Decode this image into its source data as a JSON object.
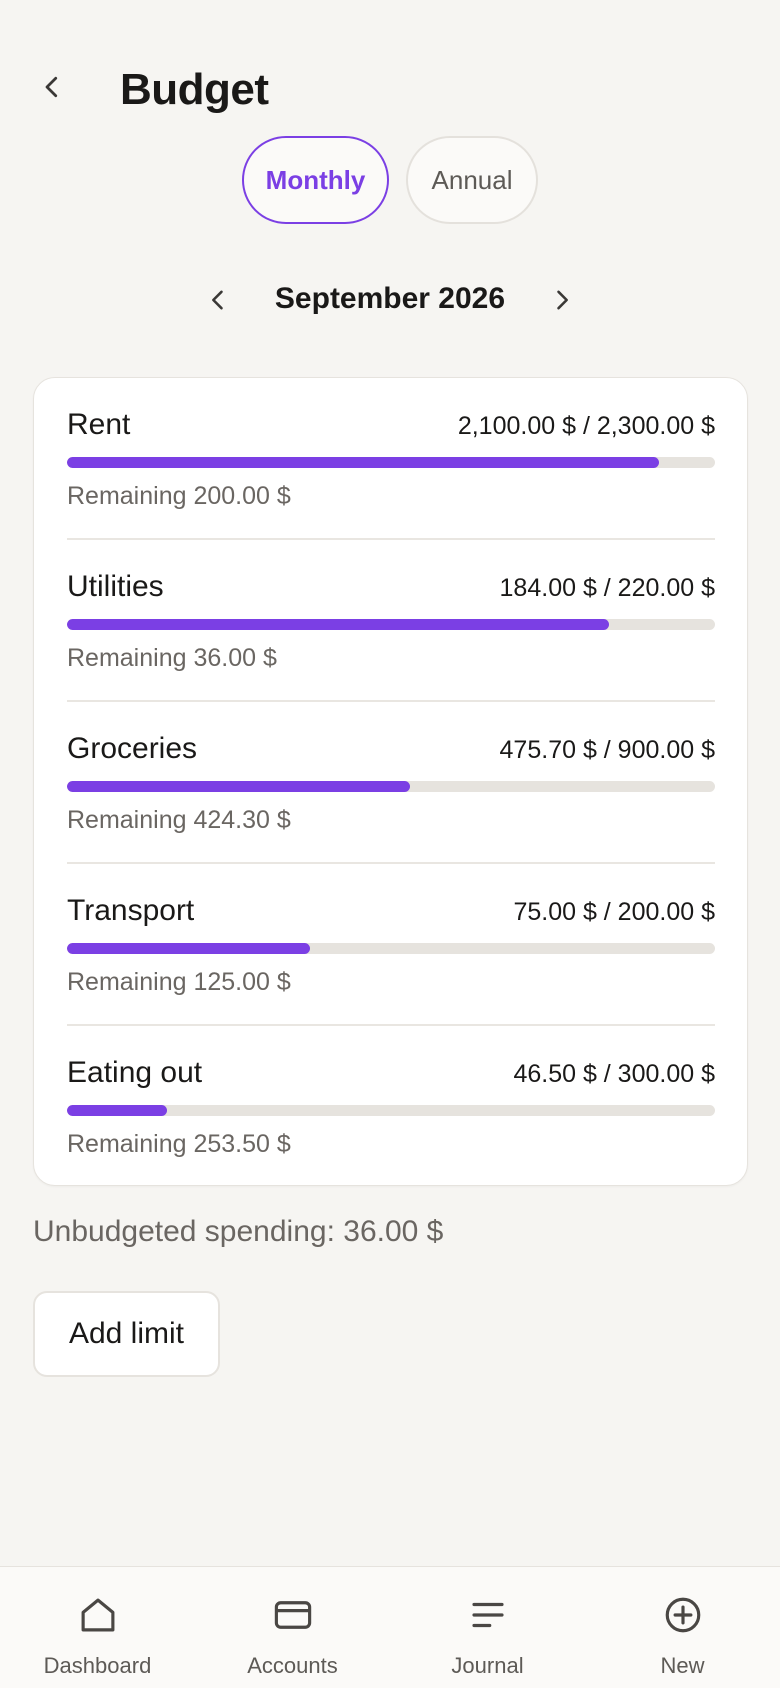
{
  "header": {
    "title": "Budget",
    "back_icon": "chevron-left-icon"
  },
  "period_toggle": {
    "options": [
      {
        "label": "Monthly",
        "selected": true
      },
      {
        "label": "Annual",
        "selected": false
      }
    ]
  },
  "period": {
    "label": "September 2026",
    "prev_icon": "chevron-left-icon",
    "next_icon": "chevron-right-icon"
  },
  "budgets": [
    {
      "name": "Rent",
      "amount": "2,100.00 $ / 2,300.00 $",
      "remaining": "Remaining 200.00 $",
      "progress": 0.913
    },
    {
      "name": "Utilities",
      "amount": "184.00 $ / 220.00 $",
      "remaining": "Remaining 36.00 $",
      "progress": 0.836
    },
    {
      "name": "Groceries",
      "amount": "475.70 $ / 900.00 $",
      "remaining": "Remaining 424.30 $",
      "progress": 0.529
    },
    {
      "name": "Transport",
      "amount": "75.00 $ / 200.00 $",
      "remaining": "Remaining 125.00 $",
      "progress": 0.375
    },
    {
      "name": "Eating out",
      "amount": "46.50 $ / 300.00 $",
      "remaining": "Remaining 253.50 $",
      "progress": 0.155
    }
  ],
  "unbudgeted": "Unbudgeted spending: 36.00 $",
  "add_limit_label": "Add limit",
  "bottom_nav": [
    {
      "label": "Dashboard",
      "icon": "home-icon"
    },
    {
      "label": "Accounts",
      "icon": "card-icon"
    },
    {
      "label": "Journal",
      "icon": "list-icon"
    },
    {
      "label": "New",
      "icon": "plus-circle-icon"
    }
  ],
  "colors": {
    "accent": "#7b3fe4",
    "track": "#e6e3de",
    "background": "#f6f5f2"
  }
}
